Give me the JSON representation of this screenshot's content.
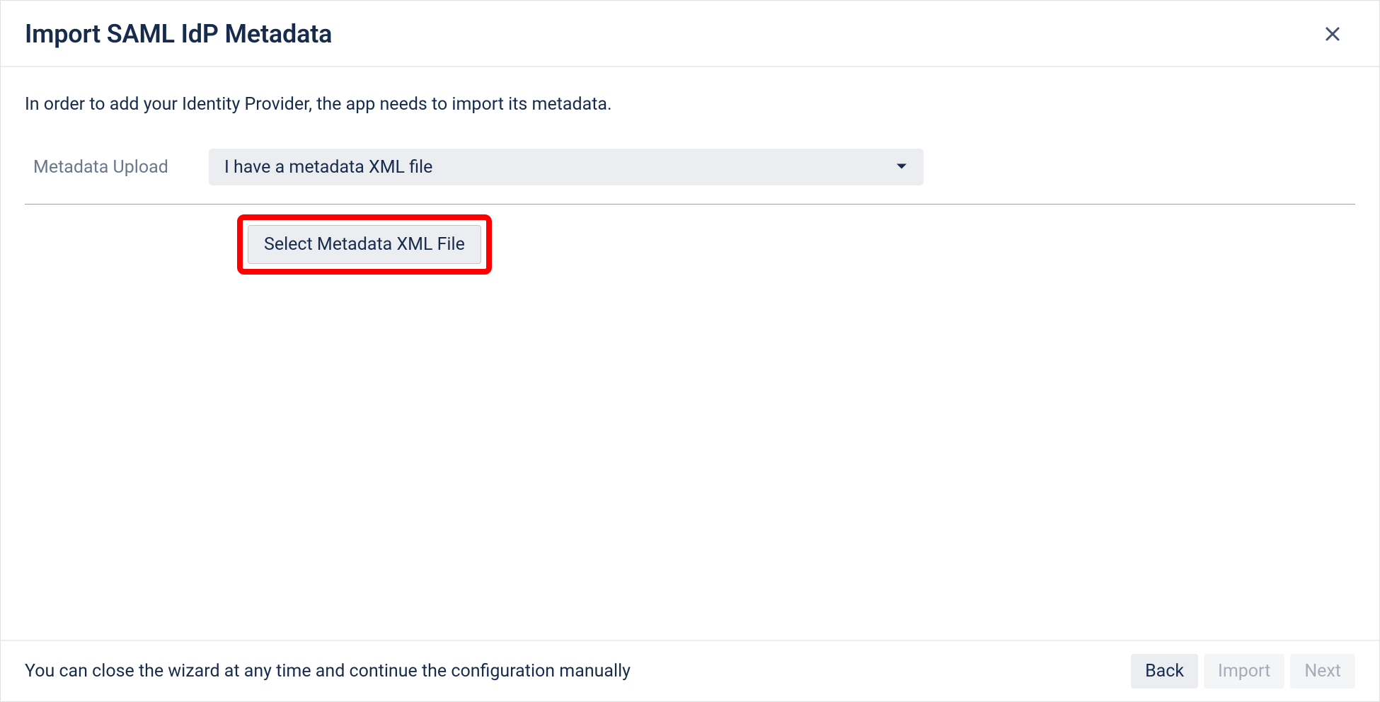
{
  "dialog": {
    "title": "Import SAML IdP Metadata",
    "intro": "In order to add your Identity Provider, the app needs to import its metadata."
  },
  "form": {
    "upload_label": "Metadata Upload",
    "upload_selected": "I have a metadata XML file",
    "select_file_button": "Select Metadata XML File"
  },
  "footer": {
    "hint": "You can close the wizard at any time and continue the configuration manually",
    "back": "Back",
    "import": "Import",
    "next": "Next"
  }
}
